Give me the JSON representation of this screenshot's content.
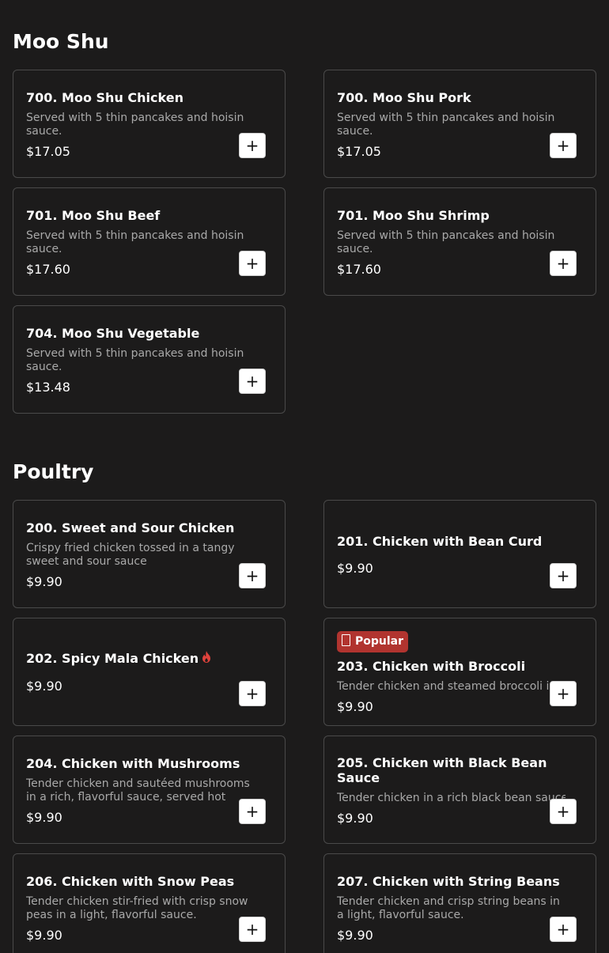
{
  "sections": [
    {
      "title": "Moo Shu",
      "items": [
        {
          "name": "700. Moo Shu Chicken",
          "desc": "Served with 5 thin pancakes and hoisin sauce.",
          "price": "$17.05",
          "add": "+"
        },
        {
          "name": "700. Moo Shu Pork",
          "desc": "Served with 5 thin pancakes and hoisin sauce.",
          "price": "$17.05",
          "add": "+"
        },
        {
          "name": "701. Moo Shu Beef",
          "desc": "Served with 5 thin pancakes and hoisin sauce.",
          "price": "$17.60",
          "add": "+"
        },
        {
          "name": "701. Moo Shu Shrimp",
          "desc": "Served with 5 thin pancakes and hoisin sauce.",
          "price": "$17.60",
          "add": "+"
        },
        {
          "name": "704. Moo Shu Vegetable",
          "desc": "Served with 5 thin pancakes and hoisin sauce.",
          "price": "$13.48",
          "add": "+"
        }
      ]
    },
    {
      "title": "Poultry",
      "items": [
        {
          "name": "200. Sweet and Sour Chicken",
          "desc": "Crispy fried chicken tossed in a tangy sweet and sour sauce",
          "price": "$9.90",
          "add": "+"
        },
        {
          "name": "201. Chicken with Bean Curd",
          "desc": "",
          "price": "$9.90",
          "add": "+"
        },
        {
          "name": "202. Spicy Mala Chicken",
          "desc": "",
          "price": "$9.90",
          "add": "+",
          "spicy_icon": "fire-icon"
        },
        {
          "name": "203. Chicken with Broccoli",
          "desc": "Tender chicken and steamed broccoli i",
          "price": "$9.90",
          "add": "+",
          "badge": "Popular",
          "badge_icon": "popular-icon"
        },
        {
          "name": "204. Chicken with Mushrooms",
          "desc": "Tender chicken and sautéed mushrooms in a rich, flavorful sauce, served hot and...",
          "price": "$9.90",
          "add": "+"
        },
        {
          "name": "205. Chicken with Black Bean Sauce",
          "desc": "Tender chicken in a rich black bean sauce",
          "price": "$9.90",
          "add": "+"
        },
        {
          "name": "206. Chicken with Snow Peas",
          "desc": "Tender chicken stir-fried with crisp snow peas in a light, flavorful sauce.",
          "price": "$9.90",
          "add": "+"
        },
        {
          "name": "207. Chicken with String Beans",
          "desc": "Tender chicken and crisp string beans in a light, flavorful sauce.",
          "price": "$9.90",
          "add": "+"
        }
      ]
    }
  ],
  "colors": {
    "background": "#1c1b1b",
    "card_border": "#4a4a4a",
    "description": "#a9a9a9",
    "badge": "#b1342f",
    "spicy": "#e0423c"
  }
}
